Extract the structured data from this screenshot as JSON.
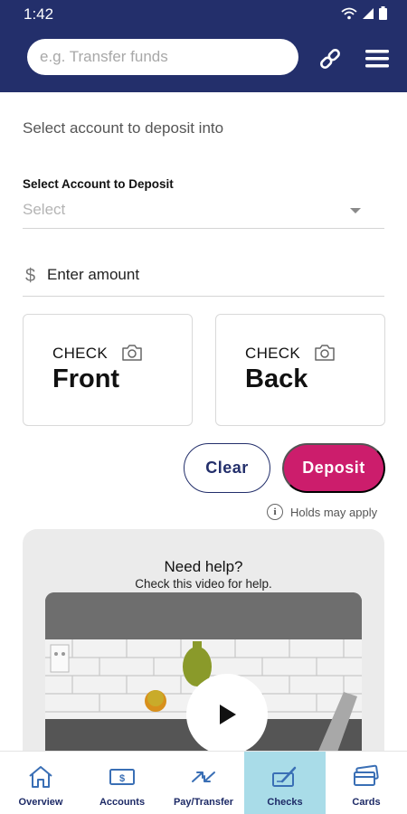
{
  "status_bar": {
    "time": "1:42"
  },
  "header": {
    "search_placeholder": "e.g. Transfer funds",
    "icons": [
      "link-icon",
      "hamburger-menu-icon"
    ]
  },
  "deposit": {
    "section_title": "Select account to deposit into",
    "account_label": "Select Account to Deposit",
    "account_value": "Select",
    "amount_symbol": "$",
    "amount_label": "Enter amount",
    "front_card": {
      "small": "CHECK",
      "big": "Front",
      "icon": "camera-icon"
    },
    "back_card": {
      "small": "CHECK",
      "big": "Back",
      "icon": "camera-icon"
    },
    "clear_label": "Clear",
    "deposit_label": "Deposit",
    "holds_text": "Holds may apply"
  },
  "help": {
    "title": "Need help?",
    "subtitle": "Check this video for help."
  },
  "bottom_nav": {
    "items": [
      {
        "label": "Overview",
        "icon": "house-icon"
      },
      {
        "label": "Accounts",
        "icon": "dollar-bill-icon"
      },
      {
        "label": "Pay/Transfer",
        "icon": "arrows-exchange-icon"
      },
      {
        "label": "Checks",
        "icon": "check-pen-icon",
        "active": true
      },
      {
        "label": "Cards",
        "icon": "credit-card-icon"
      }
    ]
  },
  "colors": {
    "header_bg": "#232f6b",
    "deposit_button": "#cc1d6c",
    "active_tab": "#a9dce8"
  }
}
